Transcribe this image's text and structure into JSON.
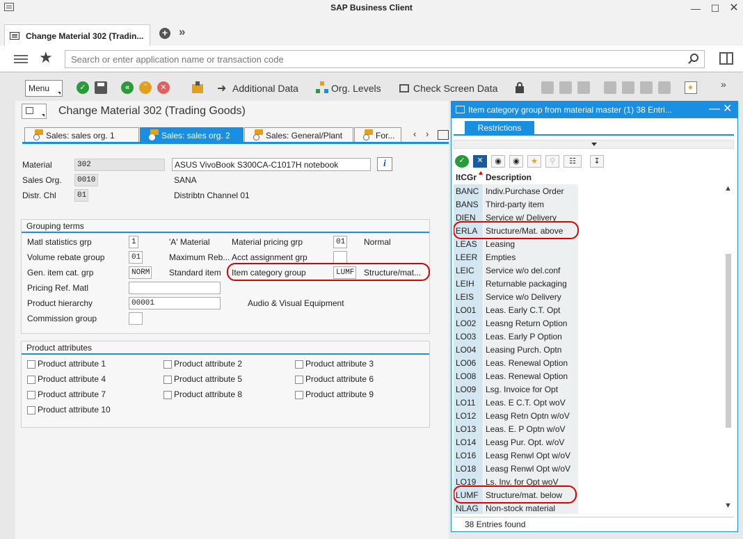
{
  "window": {
    "title": "SAP Business Client"
  },
  "tabs": {
    "active_label": "Change Material 302 (Tradin..."
  },
  "search": {
    "placeholder": "Search or enter application name or transaction code"
  },
  "toolbar": {
    "menu_label": "Menu",
    "additional_data": "Additional Data",
    "org_levels": "Org. Levels",
    "check_screen_data": "Check Screen Data"
  },
  "page": {
    "title": "Change Material 302 (Trading Goods)",
    "tabs": [
      {
        "label": "Sales: sales org. 1"
      },
      {
        "label": "Sales: sales org. 2"
      },
      {
        "label": "Sales: General/Plant"
      },
      {
        "label": "For..."
      }
    ],
    "header": {
      "material_label": "Material",
      "material_value": "302",
      "material_desc": "ASUS VivoBook S300CA-C1017H notebook",
      "sales_org_label": "Sales Org.",
      "sales_org_value": "0010",
      "sales_org_desc": "SANA",
      "distr_label": "Distr. Chl",
      "distr_value": "01",
      "distr_desc": "Distribtn Channel 01"
    },
    "grouping": {
      "title": "Grouping terms",
      "matl_stat_label": "Matl statistics grp",
      "matl_stat_value": "1",
      "matl_stat_desc": "'A' Material",
      "mat_pricing_label": "Material pricing grp",
      "mat_pricing_value": "01",
      "mat_pricing_desc": "Normal",
      "volume_rebate_label": "Volume rebate group",
      "volume_rebate_value": "01",
      "volume_rebate_desc": "Maximum Reb...",
      "acct_assign_label": "Acct assignment grp",
      "acct_assign_value": "",
      "gen_item_label": "Gen. item cat. grp",
      "gen_item_value": "NORM",
      "gen_item_desc": "Standard item",
      "item_cat_label": "Item category group",
      "item_cat_value": "LUMF",
      "item_cat_desc": "Structure/mat...",
      "pricing_ref_label": "Pricing Ref. Matl",
      "pricing_ref_value": "",
      "prod_hier_label": "Product hierarchy",
      "prod_hier_value": "00001",
      "prod_hier_desc": "Audio & Visual Equipment",
      "commission_label": "Commission group",
      "commission_value": ""
    },
    "attributes": {
      "title": "Product attributes",
      "items": [
        "Product attribute 1",
        "Product attribute 2",
        "Product attribute 3",
        "Product attribute 4",
        "Product attribute 5",
        "Product attribute 6",
        "Product attribute 7",
        "Product attribute 8",
        "Product attribute 9",
        "Product attribute 10"
      ]
    }
  },
  "popup": {
    "title": "Item category group from material master (1)   38 Entri...",
    "restrictions": "Restrictions",
    "col_key": "ItCGr",
    "col_desc": "Description",
    "rows": [
      {
        "k": "BANC",
        "d": "Indiv.Purchase Order"
      },
      {
        "k": "BANS",
        "d": "Third-party item"
      },
      {
        "k": "DIEN",
        "d": "Service w/ Delivery"
      },
      {
        "k": "ERLA",
        "d": "Structure/Mat. above"
      },
      {
        "k": "LEAS",
        "d": "Leasing"
      },
      {
        "k": "LEER",
        "d": "Empties"
      },
      {
        "k": "LEIC",
        "d": "Service w/o del.conf"
      },
      {
        "k": "LEIH",
        "d": "Returnable packaging"
      },
      {
        "k": "LEIS",
        "d": "Service w/o Delivery"
      },
      {
        "k": "LO01",
        "d": "Leas. Early C.T. Opt"
      },
      {
        "k": "LO02",
        "d": "Leasng Return Option"
      },
      {
        "k": "LO03",
        "d": "Leas. Early P Option"
      },
      {
        "k": "LO04",
        "d": "Leasing Purch. Optn"
      },
      {
        "k": "LO06",
        "d": "Leas. Renewal Option"
      },
      {
        "k": "LO08",
        "d": "Leas. Renewal Option"
      },
      {
        "k": "LO09",
        "d": "Lsg. Invoice for Opt"
      },
      {
        "k": "LO11",
        "d": "Leas. E C.T. Opt woV"
      },
      {
        "k": "LO12",
        "d": "Leasg Retn Optn w/oV"
      },
      {
        "k": "LO13",
        "d": "Leas. E. P Optn w/oV"
      },
      {
        "k": "LO14",
        "d": "Leasg Pur. Opt. w/oV"
      },
      {
        "k": "LO16",
        "d": "Leasg Renwl Opt w/oV"
      },
      {
        "k": "LO18",
        "d": "Leasg Renwl Opt w/oV"
      },
      {
        "k": "LO19",
        "d": "Ls. Inv. for Opt woV"
      },
      {
        "k": "LUMF",
        "d": "Structure/mat. below"
      },
      {
        "k": "NLAG",
        "d": "Non-stock material"
      }
    ],
    "status": "38 Entries found"
  }
}
